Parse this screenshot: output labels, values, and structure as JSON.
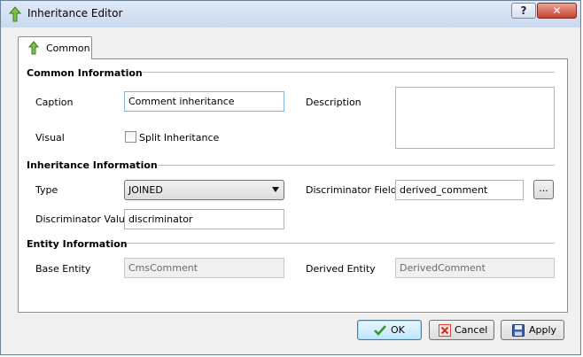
{
  "window": {
    "title": "Inheritance Editor",
    "help_label": "?",
    "close_label": "✕"
  },
  "tabs": [
    {
      "label": "Common"
    }
  ],
  "sections": {
    "common": "Common Information",
    "inheritance": "Inheritance Information",
    "entity": "Entity Information"
  },
  "fields": {
    "caption_label": "Caption",
    "caption_value": "Comment inheritance",
    "description_label": "Description",
    "description_value": "",
    "visual_label": "Visual",
    "split_inheritance_label": "Split Inheritance",
    "split_inheritance_checked": false,
    "type_label": "Type",
    "type_value": "JOINED",
    "discriminator_field_label": "Discriminator Field",
    "discriminator_field_value": "derived_comment",
    "browse_label": "...",
    "discriminator_value_label": "Discriminator Value",
    "discriminator_value_value": "discriminator",
    "base_entity_label": "Base Entity",
    "base_entity_value": "CmsComment",
    "derived_entity_label": "Derived Entity",
    "derived_entity_value": "DerivedComment"
  },
  "buttons": {
    "ok": "OK",
    "cancel": "Cancel",
    "apply": "Apply"
  },
  "icons": {
    "app": "green-up-arrow-icon",
    "tab": "green-up-arrow-icon",
    "ok": "checkmark-icon",
    "cancel": "x-icon",
    "apply": "floppy-disk-icon"
  }
}
